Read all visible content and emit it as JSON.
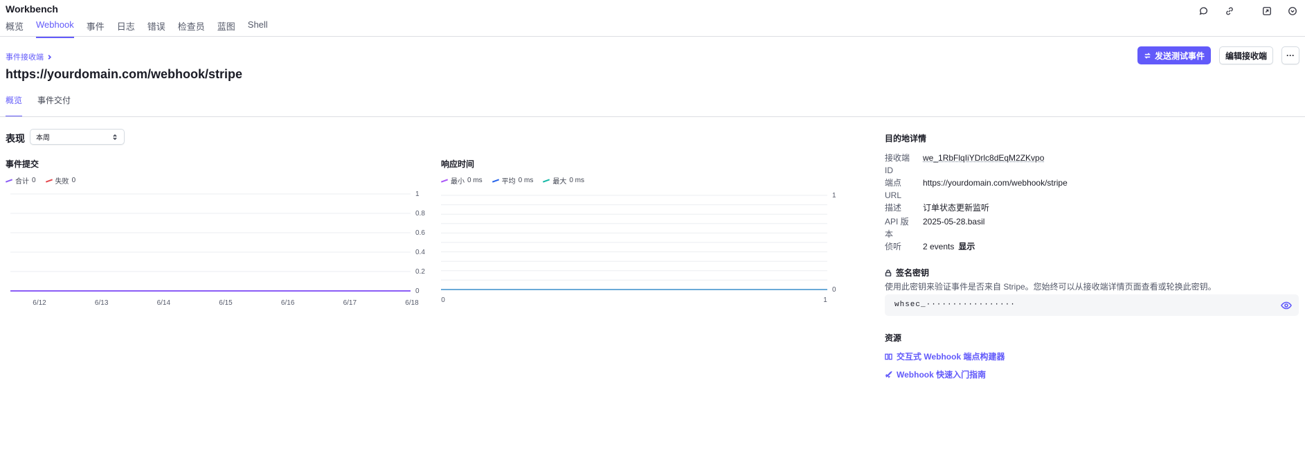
{
  "app": {
    "title": "Workbench",
    "tabs": [
      {
        "label": "概览",
        "active": false
      },
      {
        "label": "Webhook",
        "active": true
      },
      {
        "label": "事件",
        "active": false
      },
      {
        "label": "日志",
        "active": false
      },
      {
        "label": "错误",
        "active": false
      },
      {
        "label": "检查员",
        "active": false
      },
      {
        "label": "蓝图",
        "active": false
      },
      {
        "label": "Shell",
        "active": false
      }
    ],
    "header_icons": [
      "chat-icon",
      "link-icon",
      "expand-icon",
      "chevron-down-icon"
    ]
  },
  "accent_color": "#625afa",
  "breadcrumb": "事件接收端",
  "page_title": "https://yourdomain.com/webhook/stripe",
  "actions": {
    "send_test": "发送测试事件",
    "edit": "编辑接收端",
    "more": "···"
  },
  "sub_tabs": [
    {
      "label": "概览",
      "active": true
    },
    {
      "label": "事件交付",
      "active": false
    }
  ],
  "performance": {
    "label": "表现",
    "period": "本周"
  },
  "chart_data": [
    {
      "type": "line",
      "title": "事件提交",
      "series": [
        {
          "name": "合计",
          "legend_value": "0",
          "color": "#8b5cf6",
          "values": [
            0,
            0,
            0,
            0,
            0,
            0,
            0,
            0
          ]
        },
        {
          "name": "失败",
          "legend_value": "0",
          "color": "#e5484d",
          "values": [
            0,
            0,
            0,
            0,
            0,
            0,
            0,
            0
          ]
        }
      ],
      "x": [
        "6/12",
        "6/13",
        "6/14",
        "6/15",
        "6/16",
        "6/17",
        "6/18"
      ],
      "ylim": [
        0,
        1
      ],
      "yticks": [
        "1",
        "0.8",
        "0.6",
        "0.4",
        "0.2",
        "0"
      ],
      "grid": true
    },
    {
      "type": "line",
      "title": "响应时间",
      "series": [
        {
          "name": "最小",
          "legend_value": "0 ms",
          "color": "#a855f7",
          "values": [
            0,
            0
          ]
        },
        {
          "name": "平均",
          "legend_value": "0 ms",
          "color": "#2563eb",
          "values": [
            0,
            0
          ]
        },
        {
          "name": "最大",
          "legend_value": "0 ms",
          "color": "#14b8a6",
          "values": [
            0,
            0
          ]
        }
      ],
      "x": [
        "0",
        "1"
      ],
      "ylim": [
        0,
        1
      ],
      "yticks": [
        "1",
        "0"
      ],
      "grid": true
    }
  ],
  "destination": {
    "title": "目的地详情",
    "rows": [
      {
        "key": "接收端 ID",
        "value": "we_1RbFlqIiYDrlc8dEqM2ZKvpo"
      },
      {
        "key": "端点 URL",
        "value": "https://yourdomain.com/webhook/stripe"
      },
      {
        "key": "描述",
        "value": "订单状态更新监听"
      },
      {
        "key": "API 版本",
        "value": "2025-05-28.basil"
      },
      {
        "key": "侦听",
        "value": "2 events",
        "link": "显示"
      }
    ]
  },
  "signing": {
    "title": "签名密钥",
    "description": "使用此密钥来验证事件是否来自 Stripe。您始终可以从接收端详情页面查看或轮换此密钥。",
    "secret": "whsec_·················"
  },
  "resources": {
    "title": "资源",
    "links": [
      {
        "label": "交互式 Webhook 端点构建器",
        "icon": "book-icon"
      },
      {
        "label": "Webhook 快速入门指南",
        "icon": "rocket-icon"
      }
    ]
  }
}
